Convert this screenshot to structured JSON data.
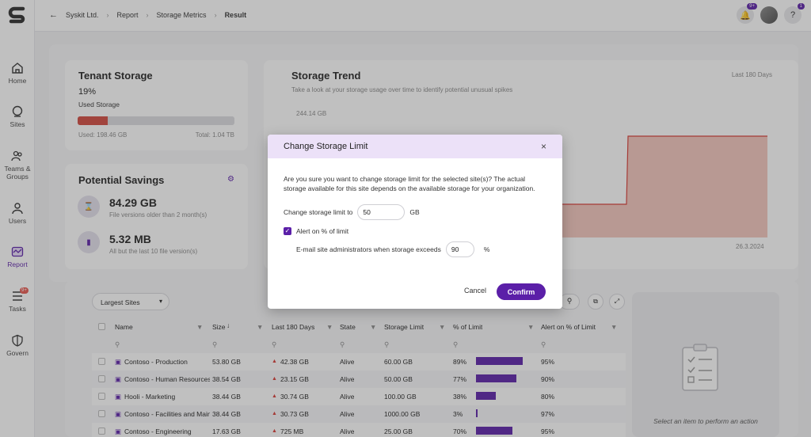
{
  "nav": {
    "items": [
      {
        "label": "Home",
        "icon": "home-icon"
      },
      {
        "label": "Sites",
        "icon": "globe-icon"
      },
      {
        "label": "Teams &",
        "label2": "Groups",
        "icon": "teams-icon"
      },
      {
        "label": "Users",
        "icon": "user-icon"
      },
      {
        "label": "Report",
        "icon": "report-icon"
      },
      {
        "label": "Tasks",
        "icon": "tasks-icon",
        "badge": "9+"
      },
      {
        "label": "Govern",
        "icon": "shield-icon"
      }
    ]
  },
  "breadcrumb": [
    "Syskit Ltd.",
    "Report",
    "Storage Metrics",
    "Result"
  ],
  "topbar": {
    "notif_badge": "9+",
    "help_badge": "1",
    "help_label": "?"
  },
  "tenant": {
    "title": "Tenant Storage",
    "percent": "19%",
    "percent_label": "Used Storage",
    "used_fraction": 0.19,
    "used": "Used: 198.46 GB",
    "total": "Total: 1.04 TB"
  },
  "savings": {
    "title": "Potential Savings",
    "items": [
      {
        "value": "84.29 GB",
        "desc": "File versions older than 2 month(s)"
      },
      {
        "value": "5.32 MB",
        "desc": "All but the last 10 file version(s)"
      }
    ]
  },
  "trend": {
    "title": "Storage Trend",
    "subtitle": "Take a look at your storage usage over time to identify potential unusual spikes",
    "range": "Last 180 Days",
    "ymax_label": "244.14 GB",
    "date_label": "26.3.2024"
  },
  "modal": {
    "title": "Change Storage Limit",
    "close": "×",
    "message": "Are you sure you want to change storage limit for the selected site(s)? The actual storage available for this site depends on the available storage for your organization.",
    "limit_label": "Change storage limit to",
    "limit_value": "50",
    "limit_unit": "GB",
    "alert_label": "Alert on % of limit",
    "email_label": "E-mail site administrators when storage exceeds",
    "email_value": "90",
    "email_unit": "%",
    "cancel": "Cancel",
    "confirm": "Confirm"
  },
  "table": {
    "dropdown": "Largest Sites",
    "headers": [
      "Name",
      "Size",
      "Last 180 Days",
      "State",
      "Storage Limit",
      "% of Limit",
      "Alert on % of Limit"
    ],
    "side_text": "Select an item to perform an action",
    "rows": [
      {
        "name": "Contoso - Production",
        "size": "53.80 GB",
        "trend": "42.38 GB",
        "state": "Alive",
        "limit": "60.00 GB",
        "pct": "89%",
        "pct_value": 89,
        "alert": "95%"
      },
      {
        "name": "Contoso - Human Resources",
        "size": "38.54 GB",
        "trend": "23.15 GB",
        "state": "Alive",
        "limit": "50.00 GB",
        "pct": "77%",
        "pct_value": 77,
        "alert": "90%"
      },
      {
        "name": "Hooli - Marketing",
        "size": "38.44 GB",
        "trend": "30.74 GB",
        "state": "Alive",
        "limit": "100.00 GB",
        "pct": "38%",
        "pct_value": 38,
        "alert": "80%"
      },
      {
        "name": "Contoso - Facilities and Main",
        "size": "38.44 GB",
        "trend": "30.73 GB",
        "state": "Alive",
        "limit": "1000.00 GB",
        "pct": "3%",
        "pct_value": 3,
        "alert": "97%"
      },
      {
        "name": "Contoso - Engineering",
        "size": "17.63 GB",
        "trend": "725 MB",
        "state": "Alive",
        "limit": "25.00 GB",
        "pct": "70%",
        "pct_value": 70,
        "alert": "95%"
      }
    ]
  },
  "colors": {
    "accent": "#5b1fa8",
    "trend_line": "#d83a34",
    "trend_fill": "#f4c6bd"
  }
}
